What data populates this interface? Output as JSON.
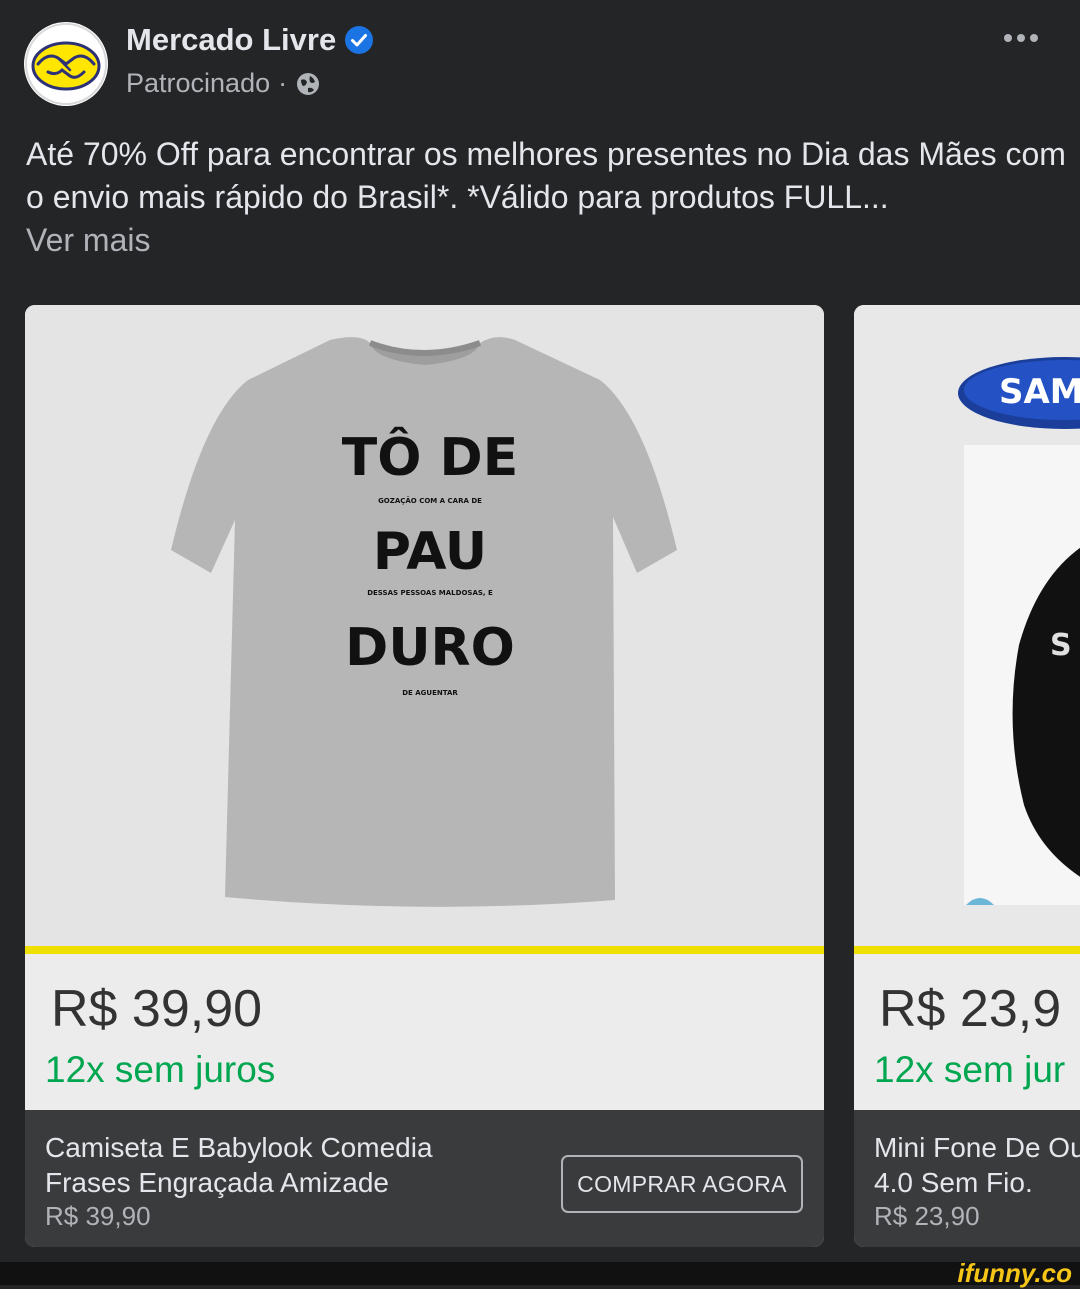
{
  "post": {
    "page_name": "Mercado Livre",
    "sponsored_label": "Patrocinado",
    "separator": "·",
    "text": "Até 70% Off para encontrar os melhores presentes no Dia das Mães com o envio mais rápido do Brasil*. *Válido para produtos FULL...",
    "see_more": "Ver mais"
  },
  "carousel": [
    {
      "image_text": {
        "line1": "TÔ DE",
        "small1": "GOZAÇÃO COM A CARA DE",
        "line2": "PAU",
        "small2": "DESSAS PESSOAS MALDOSAS, E",
        "line3": "DURO",
        "small3": "DE AGUENTAR"
      },
      "price": "R$ 39,90",
      "installments": "12x sem juros",
      "title_line1": "Camiseta E Babylook Comedia",
      "title_line2": "Frases Engraçada Amizade",
      "footer_price": "R$ 39,90",
      "cta": "COMPRAR AGORA"
    },
    {
      "image_text": {
        "brand": "SAM",
        "partial": "S"
      },
      "price": "R$ 23,9",
      "installments": "12x sem jur",
      "title_line1": "Mini Fone De Ou",
      "title_line2": "4.0  Sem Fio.",
      "footer_price": "R$ 23,90"
    }
  ],
  "watermark": "ifunny.co",
  "colors": {
    "background": "#242526",
    "installments_green": "#00a650",
    "yellow_accent": "#f0e000",
    "verified_blue": "#1b74e4"
  },
  "icons": {
    "avatar": "mercado-livre-handshake-logo",
    "verified": "verified-badge-icon",
    "audience": "globe-icon",
    "more": "more-options-icon"
  }
}
